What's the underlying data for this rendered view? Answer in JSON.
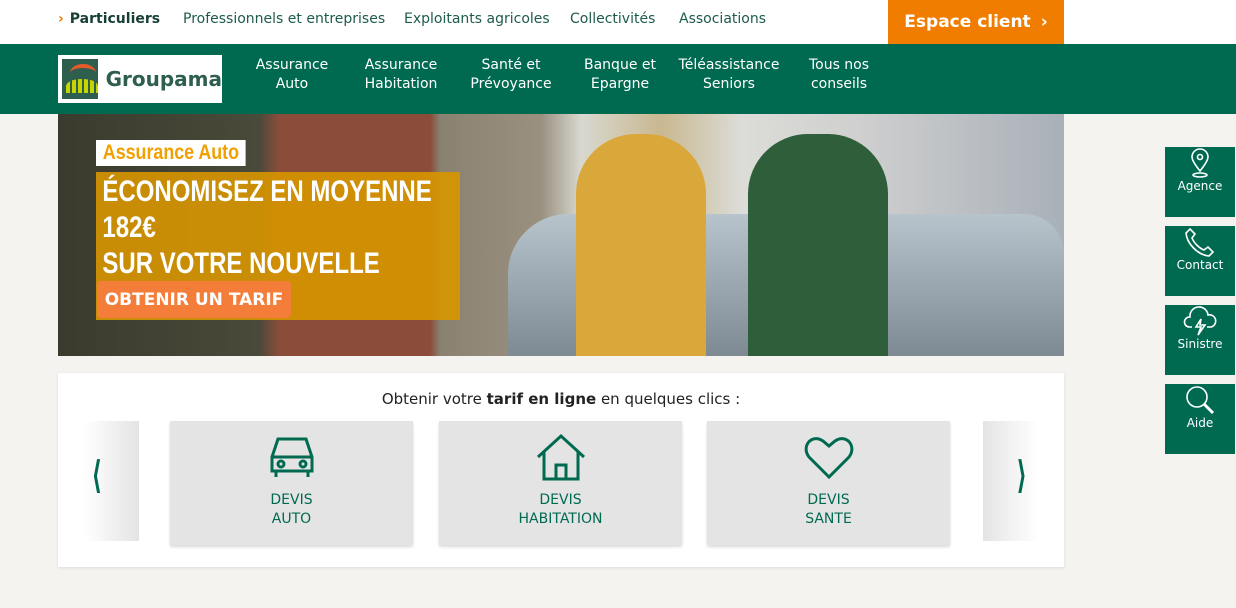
{
  "topbar": {
    "links": [
      "Particuliers",
      "Professionnels et entreprises",
      "Exploitants agricoles",
      "Collectivités",
      "Associations"
    ],
    "espace_client": "Espace client"
  },
  "nav": {
    "logo": "Groupama",
    "items": [
      [
        "Assurance",
        "Auto"
      ],
      [
        "Assurance",
        "Habitation"
      ],
      [
        "Santé et",
        "Prévoyance"
      ],
      [
        "Banque et",
        "Epargne"
      ],
      [
        "Téléassistance",
        "Seniors"
      ],
      [
        "Tous nos",
        "conseils"
      ]
    ]
  },
  "hero": {
    "tag": "Assurance Auto",
    "headline1": "ÉCONOMISEZ EN MOYENNE 182€",
    "headline2": "SUR VOTRE NOUVELLE ASSURANCE*",
    "cta": "OBTENIR UN TARIF"
  },
  "quotes": {
    "title_pre": "Obtenir votre ",
    "title_bold": "tarif en ligne",
    "title_post": " en quelques clics :",
    "cards": [
      {
        "icon": "car-icon",
        "l1": "DEVIS",
        "l2": "AUTO"
      },
      {
        "icon": "house-icon",
        "l1": "DEVIS",
        "l2": "HABITATION"
      },
      {
        "icon": "heart-icon",
        "l1": "DEVIS",
        "l2": "SANTE"
      }
    ]
  },
  "sidebar": [
    "Agence",
    "Contact",
    "Sinistre",
    "Aide"
  ],
  "colors": {
    "brand_green": "#006a51",
    "accent_orange": "#f07d00"
  }
}
